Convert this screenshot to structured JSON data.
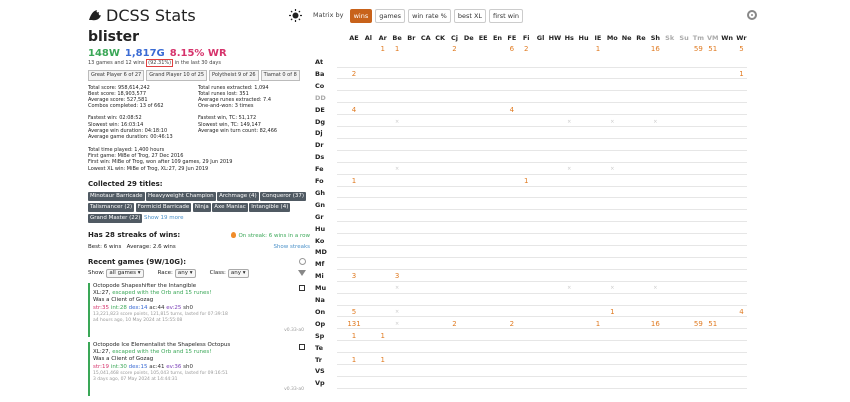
{
  "site": {
    "title": "DCSS Stats"
  },
  "player": {
    "name": "blister",
    "wins": "148W",
    "gold": "1,817G",
    "winrate": "8.15% WR",
    "recent_prefix": "13 games and 12 wins",
    "recent_highlight": "(92.31%)",
    "recent_suffix": "in the last 30 days"
  },
  "badges": [
    "Great Player 6 of 27",
    "Grand Player 10 of 25",
    "Polytheist 9 of 26",
    "Tiamat 0 of 8"
  ],
  "stats": {
    "left": [
      "Total score: 958,614,242",
      "Best score: 18,903,577",
      "Average score: 527,581",
      "Combos completed: 13 of 662",
      "",
      "Fastest win: 02:08:52",
      "Slowest win: 16:03:14",
      "Average win duration: 04:18:10",
      "Average game duration: 00:46:13"
    ],
    "right": [
      "Total runes extracted: 1,094",
      "Total runes lost: 351",
      "Average runes extracted: 7.4",
      "One-and-won: 3 times",
      "",
      "Fastest win, TC: 51,172",
      "Slowest win, TC: 149,147",
      "Average win turn count: 82,466"
    ]
  },
  "life": [
    "Total time played: 1,400 hours",
    "First game: MiBe of Trog, 27 Dec 2016",
    "First win: MiBe of Trog, won after 109 games, 29 Jun 2019",
    "Lowest XL win: MiBe of Trog, XL:27, 29 Jun 2019"
  ],
  "titles": {
    "heading": "Collected 29 titles:",
    "items": [
      "Minotaur Barricade",
      "Heavyweight Champion",
      "Archmage (4)",
      "Conqueror (37)",
      "Talismancer (2)",
      "Formicid Barricade",
      "Ninja",
      "Axe Maniac",
      "Intangible (4)",
      "Grand Master (22)"
    ],
    "show_more": "Show 19 more"
  },
  "streaks": {
    "heading": "Has 28 streaks of wins:",
    "on_streak": "On streak: 6 wins in a row",
    "best": "Best: 6 wins",
    "average": "Average: 2.6 wins",
    "show": "Show streaks"
  },
  "recent_games": {
    "heading": "Recent games (9W/10G):",
    "show_label": "Show:",
    "show_value": "all games",
    "race_label": "Race:",
    "race_value": "any",
    "class_label": "Class:",
    "class_value": "any",
    "games": [
      {
        "title": "Octopode Shapeshifter the Intangible",
        "xl": "XL:27,",
        "result": "escaped with the Orb and 15 runes!",
        "god": "Was a Client of Gozag",
        "str": "str:35",
        "int": "int:28",
        "dex": "dex:14",
        "ac": "ac:44",
        "ev": "ev:25",
        "sh": "sh0",
        "meta": "13,221,823 score points, 121,815 turns, lasted for 07:39:18",
        "date": "a4 hours ago, 10 May 2024 at 15:55:08",
        "version": "v0.33-a0"
      },
      {
        "title": "Octopode Ice Elementalist the Shapeless Octopus",
        "xl": "XL:27,",
        "result": "escaped with the Orb and 15 runes!",
        "god": "Was a Client of Gozag",
        "str": "str:19",
        "int": "int:30",
        "dex": "dex:15",
        "ac": "ac:41",
        "ev": "ev:36",
        "sh": "sh0",
        "meta": "15,041,468 score points, 105,043 turns, lasted for 09:16:51",
        "date": "3 days ago, 07 May 2024 at 14:44:31",
        "version": "v0.33-a0"
      }
    ]
  },
  "toolbar": {
    "label": "Matrix by",
    "buttons": [
      "wins",
      "games",
      "win rate %",
      "best XL",
      "first win"
    ],
    "active": "wins"
  },
  "matrix": {
    "columns": [
      "AE",
      "Al",
      "Ar",
      "Be",
      "Br",
      "CA",
      "CK",
      "Cj",
      "De",
      "EE",
      "En",
      "FE",
      "Fi",
      "Gl",
      "HW",
      "Hs",
      "Hu",
      "IE",
      "Mo",
      "Ne",
      "Re",
      "Sh",
      "Sk",
      "Su",
      "Tm",
      "VM",
      "Wn",
      "Wr"
    ],
    "dim_columns": [
      "Sk",
      "Su",
      "Tm",
      "VM"
    ],
    "totals": [
      "",
      "",
      "1",
      "1",
      "",
      "",
      "",
      "2",
      "",
      "",
      "",
      "6",
      "2",
      "",
      "",
      "",
      "",
      "1",
      "",
      "",
      "",
      "16",
      "",
      "",
      "59",
      "51",
      "",
      "5"
    ],
    "rows": [
      "At",
      "Ba",
      "Co",
      "DD",
      "DE",
      "Dg",
      "Dj",
      "Dr",
      "Ds",
      "Fe",
      "Fo",
      "Gh",
      "Gn",
      "Gr",
      "Hu",
      "Ko",
      "MD",
      "Mf",
      "Mi",
      "Mu",
      "Na",
      "On",
      "Op",
      "Sp",
      "Te",
      "Tr",
      "VS",
      "Vp"
    ],
    "dim_rows": [
      "DD"
    ],
    "cells": [
      {
        "r": "Ba",
        "c": "AE",
        "v": "2"
      },
      {
        "r": "Ba",
        "c": "Wr",
        "v": "1"
      },
      {
        "r": "DE",
        "c": "AE",
        "v": "4"
      },
      {
        "r": "DE",
        "c": "FE",
        "v": "4"
      },
      {
        "r": "Fo",
        "c": "AE",
        "v": "1"
      },
      {
        "r": "Fo",
        "c": "Fi",
        "v": "1"
      },
      {
        "r": "Mi",
        "c": "AE",
        "v": "3"
      },
      {
        "r": "Mi",
        "c": "Be",
        "v": "3"
      },
      {
        "r": "On",
        "c": "AE",
        "v": "5"
      },
      {
        "r": "On",
        "c": "Mo",
        "v": "1"
      },
      {
        "r": "On",
        "c": "Wr",
        "v": "4"
      },
      {
        "r": "Op",
        "c": "AE",
        "v": "131"
      },
      {
        "r": "Op",
        "c": "Cj",
        "v": "2"
      },
      {
        "r": "Op",
        "c": "FE",
        "v": "2"
      },
      {
        "r": "Op",
        "c": "IE",
        "v": "1"
      },
      {
        "r": "Op",
        "c": "Sh",
        "v": "16"
      },
      {
        "r": "Op",
        "c": "Tm",
        "v": "59"
      },
      {
        "r": "Op",
        "c": "VM",
        "v": "51"
      },
      {
        "r": "Sp",
        "c": "AE",
        "v": "1"
      },
      {
        "r": "Sp",
        "c": "Ar",
        "v": "1"
      },
      {
        "r": "Tr",
        "c": "AE",
        "v": "1"
      },
      {
        "r": "Tr",
        "c": "Ar",
        "v": "1"
      }
    ],
    "disabled": [
      {
        "r": "Dg",
        "c": "Be"
      },
      {
        "r": "Dg",
        "c": "Hs"
      },
      {
        "r": "Dg",
        "c": "Mo"
      },
      {
        "r": "Dg",
        "c": "Sh"
      },
      {
        "r": "Fe",
        "c": "Be"
      },
      {
        "r": "Fe",
        "c": "Hs"
      },
      {
        "r": "Fe",
        "c": "Mo"
      },
      {
        "r": "Mu",
        "c": "Be"
      },
      {
        "r": "Mu",
        "c": "Hs"
      },
      {
        "r": "Mu",
        "c": "Mo"
      },
      {
        "r": "Mu",
        "c": "Sh"
      },
      {
        "r": "On",
        "c": "Be"
      },
      {
        "r": "Op",
        "c": "Be"
      }
    ]
  }
}
